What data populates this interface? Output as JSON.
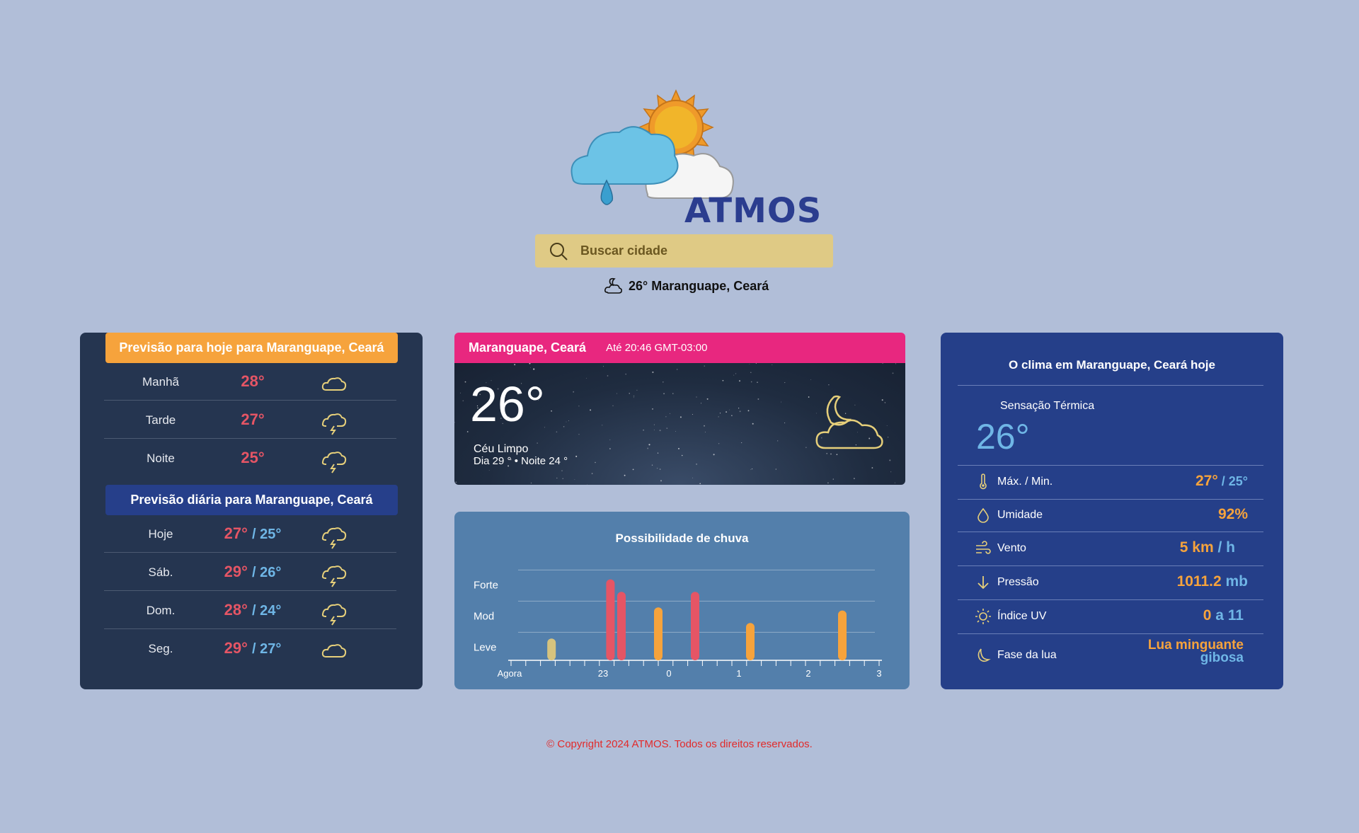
{
  "brand": {
    "name": "ATMOS"
  },
  "search": {
    "placeholder": "Buscar cidade"
  },
  "current_summary": {
    "text": "26° Maranguape, Ceará"
  },
  "today_forecast": {
    "title": "Previsão para hoje para Maranguape, Ceará",
    "rows": [
      {
        "label": "Manhã",
        "temp": "28°",
        "icon": "cloud-icon"
      },
      {
        "label": "Tarde",
        "temp": "27°",
        "icon": "thunder-icon"
      },
      {
        "label": "Noite",
        "temp": "25°",
        "icon": "thunder-icon"
      }
    ]
  },
  "daily_forecast": {
    "title": "Previsão diária para Maranguape, Ceará",
    "rows": [
      {
        "label": "Hoje",
        "max": "27°",
        "min": "/ 25°",
        "icon": "thunder-icon"
      },
      {
        "label": "Sáb.",
        "max": "29°",
        "min": "/ 26°",
        "icon": "thunder-icon"
      },
      {
        "label": "Dom.",
        "max": "28°",
        "min": "/ 24°",
        "icon": "thunder-icon"
      },
      {
        "label": "Seg.",
        "max": "29°",
        "min": "/ 27°",
        "icon": "cloud-icon"
      }
    ]
  },
  "current": {
    "city": "Maranguape, Ceará",
    "updated": "Até 20:46 GMT-03:00",
    "temp": "26°",
    "description": "Céu Limpo",
    "day_night": "Dia 29 ° • Noite 24 °",
    "icon": "moon-cloud-icon"
  },
  "rain": {
    "title": "Possibilidade de chuva"
  },
  "chart_data": {
    "type": "bar",
    "title": "Possibilidade de chuva",
    "y_levels": [
      "Leve",
      "Mod",
      "Forte"
    ],
    "x_tick_labels": [
      "Agora",
      "23",
      "0",
      "1",
      "2",
      "3"
    ],
    "values": [
      0.35,
      1.3,
      1.1,
      0.85,
      1.1,
      0.6,
      0.8
    ],
    "bar_positions": [
      0.55,
      1.35,
      1.5,
      2.0,
      2.5,
      3.25,
      4.5
    ],
    "bar_colors": [
      "#d6c37e",
      "#e55565",
      "#e55565",
      "#f6a33c",
      "#e55565",
      "#f6a33c",
      "#f6a33c"
    ],
    "ylim": [
      0,
      1.5
    ],
    "grid": true
  },
  "details": {
    "title": "O clima em Maranguape, Ceará hoje",
    "feels_label": "Sensação Térmica",
    "feels": "26°",
    "maxmin": {
      "label": "Máx. / Min.",
      "max": "27°",
      "min": " / 25°"
    },
    "humidity": {
      "label": "Umidade",
      "value": "92%"
    },
    "wind": {
      "label": "Vento",
      "value": "5 km",
      "unit": " / h"
    },
    "pressure": {
      "label": "Pressão",
      "value": "1011.2",
      "unit": " mb"
    },
    "uv": {
      "label": "Índice UV",
      "value": "0",
      "unit": " a 11"
    },
    "moon": {
      "label": "Fase da lua",
      "value1": "Lua minguante",
      "value2": "gibosa"
    }
  },
  "footer": {
    "text": "© Copyright 2024 ATMOS. Todos os direitos reservados."
  },
  "colors": {
    "background": "#b1bed8",
    "accent_orange": "#f6a33c",
    "accent_pink": "#e8277f",
    "temp_red": "#e55565",
    "temp_blue": "#6fb6e6"
  }
}
